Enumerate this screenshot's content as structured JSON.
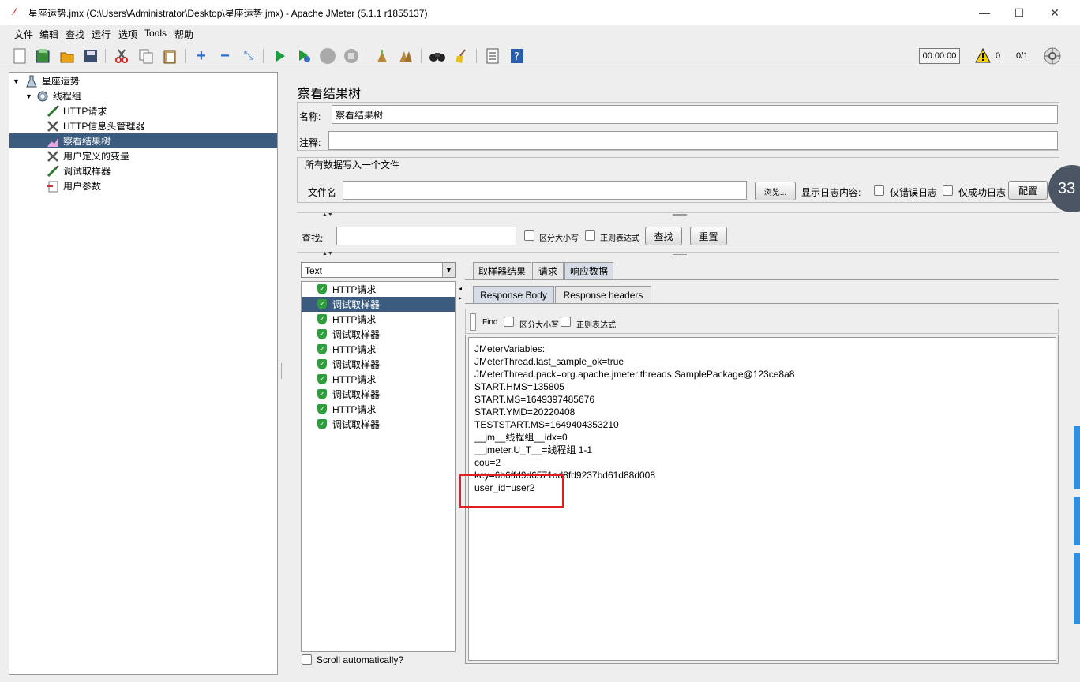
{
  "window": {
    "title": "星座运势.jmx (C:\\Users\\Administrator\\Desktop\\星座运势.jmx) - Apache JMeter (5.1.1 r1855137)",
    "minimize": "—",
    "maximize": "☐",
    "close": "✕"
  },
  "menu": [
    "文件",
    "编辑",
    "查找",
    "运行",
    "选项",
    "Tools",
    "帮助"
  ],
  "toolbar": {
    "timer": "00:00:00",
    "warnings": "0",
    "threads": "0/1"
  },
  "tree": {
    "root": "星座运势",
    "thread_group": "线程组",
    "items": [
      "HTTP请求",
      "HTTP信息头管理器",
      "察看结果树",
      "用户定义的变量",
      "调试取样器",
      "用户参数"
    ],
    "selected_index": 2
  },
  "panel": {
    "title": "察看结果树",
    "name_label": "名称:",
    "name_value": "察看结果树",
    "comment_label": "注释:",
    "comment_value": "",
    "file_section": "所有数据写入一个文件",
    "filename_label": "文件名",
    "filename_value": "",
    "browse_button": "浏览...",
    "log_label": "显示日志内容:",
    "errors_only": "仅错误日志",
    "success_only": "仅成功日志",
    "config_button": "配置",
    "search_label": "查找:",
    "search_value": "",
    "case_sensitive": "区分大小写",
    "regex": "正则表达式",
    "find_button": "查找",
    "reset_button": "重置",
    "side_badge": "33"
  },
  "results": {
    "renderer": "Text",
    "items": [
      "HTTP请求",
      "调试取样器",
      "HTTP请求",
      "调试取样器",
      "HTTP请求",
      "调试取样器",
      "HTTP请求",
      "调试取样器",
      "HTTP请求",
      "调试取样器"
    ],
    "selected_index": 1,
    "scroll_auto": "Scroll automatically?"
  },
  "tabs": {
    "main": [
      "取样器结果",
      "请求",
      "响应数据"
    ],
    "sub": [
      "Response Body",
      "Response headers"
    ]
  },
  "find_bar": {
    "find_label": "Find",
    "case_sensitive": "区分大小写",
    "regex": "正则表达式"
  },
  "response_body": [
    "JMeterVariables:",
    "JMeterThread.last_sample_ok=true",
    "JMeterThread.pack=org.apache.jmeter.threads.SamplePackage@123ce8a8",
    "START.HMS=135805",
    "START.MS=1649397485676",
    "START.YMD=20220408",
    "TESTSTART.MS=1649404353210",
    "__jm__线程组__idx=0",
    "__jmeter.U_T__=线程组 1-1",
    "cou=2",
    "key=6b6ffd9d6571ad8fd9237bd61d88d008",
    "user_id=user2"
  ],
  "colors": {
    "selection": "#3b5c7e",
    "highlight_box": "#e02020",
    "success": "#2e9e3c"
  }
}
